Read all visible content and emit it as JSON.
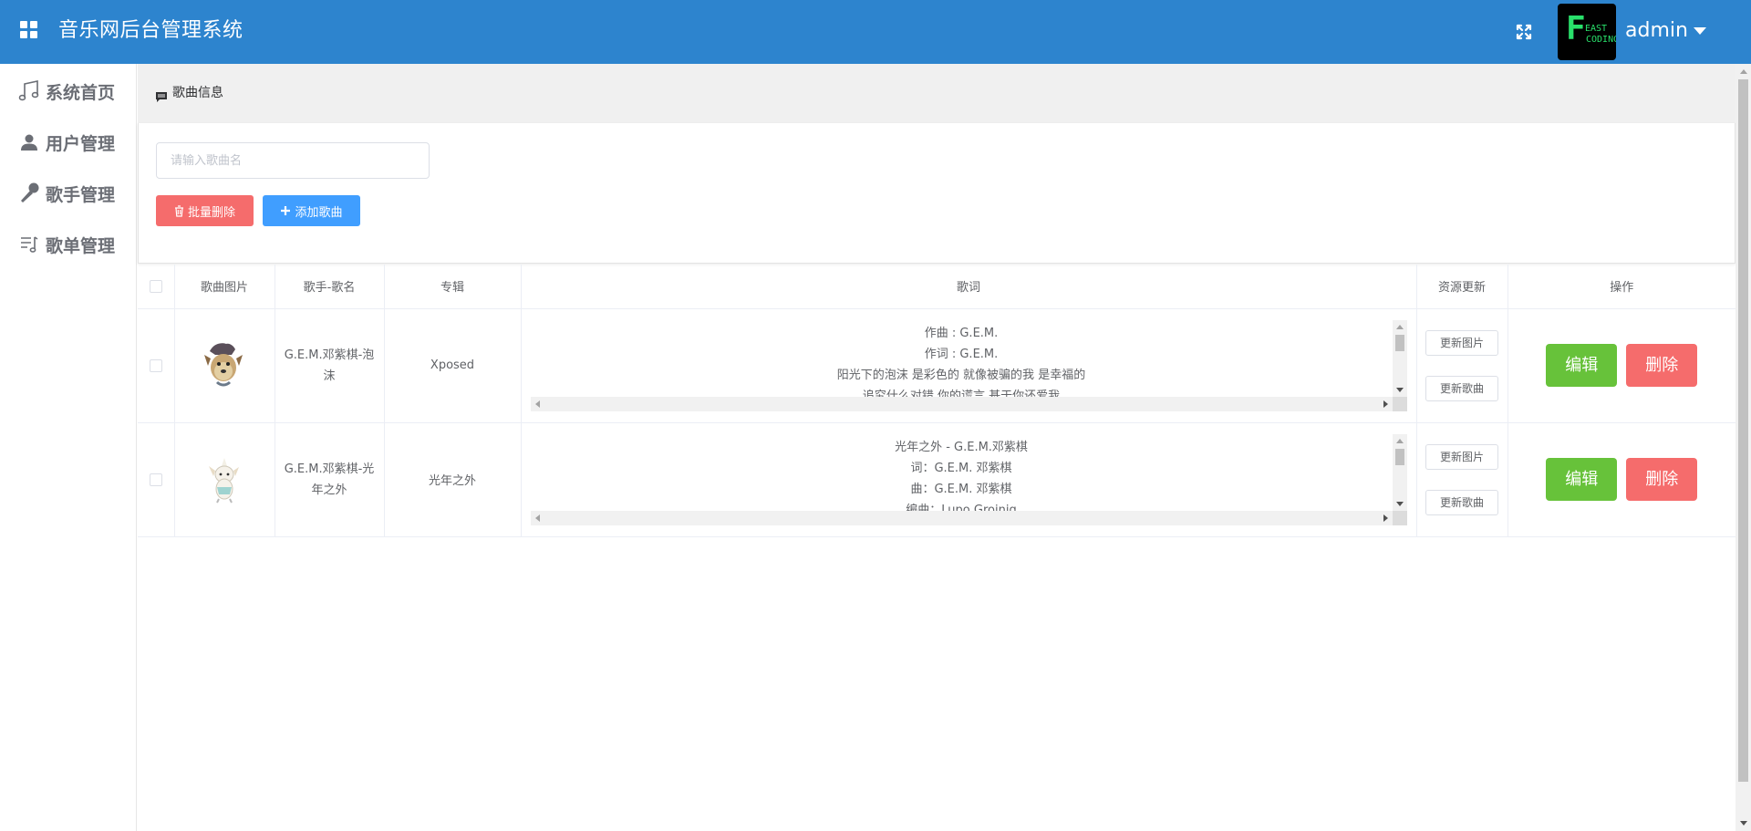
{
  "header": {
    "title": "音乐网后台管理系统",
    "user": "admin",
    "avatar_text": "EAST CODING",
    "bg_color": "#2d84ce"
  },
  "sidebar": {
    "items": [
      {
        "label": "系统首页",
        "icon": "music-note-icon"
      },
      {
        "label": "用户管理",
        "icon": "user-icon"
      },
      {
        "label": "歌手管理",
        "icon": "microphone-icon"
      },
      {
        "label": "歌单管理",
        "icon": "playlist-icon"
      }
    ]
  },
  "breadcrumb": {
    "label": "歌曲信息"
  },
  "toolbar": {
    "search_placeholder": "请输入歌曲名",
    "batch_delete_label": "批量删除",
    "add_song_label": "添加歌曲"
  },
  "table": {
    "headers": [
      "歌曲图片",
      "歌手-歌名",
      "专辑",
      "歌词",
      "资源更新",
      "操作"
    ],
    "rows": [
      {
        "singer_song": "G.E.M.邓紫棋-泡沫",
        "album": "Xposed",
        "lyrics": [
          "作曲 : G.E.M.",
          "作词 : G.E.M.",
          "阳光下的泡沫 是彩色的 就像被骗的我 是幸福的",
          "追究什么对错 你的谎言 基于你还爱我"
        ],
        "update_image_label": "更新图片",
        "update_song_label": "更新歌曲",
        "edit_label": "编辑",
        "delete_label": "删除"
      },
      {
        "singer_song": "G.E.M.邓紫棋-光年之外",
        "album": "光年之外",
        "lyrics": [
          "光年之外 - G.E.M.邓紫棋",
          "词：G.E.M. 邓紫棋",
          "曲：G.E.M. 邓紫棋",
          "编曲：Lupo Groinig"
        ],
        "update_image_label": "更新图片",
        "update_song_label": "更新歌曲",
        "edit_label": "编辑",
        "delete_label": "删除"
      }
    ]
  },
  "colors": {
    "danger": "#f56c6c",
    "primary": "#409eff",
    "success": "#67c23a"
  }
}
